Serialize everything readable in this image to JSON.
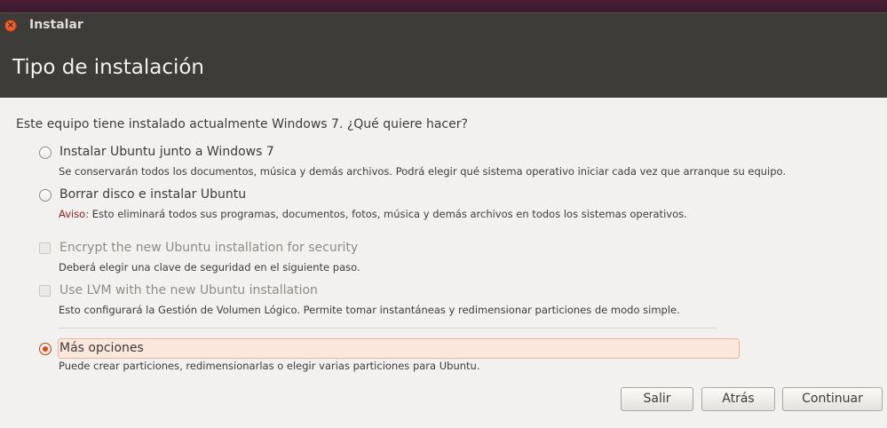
{
  "window": {
    "title": "Instalar",
    "close_icon": "close-icon"
  },
  "header": {
    "title": "Tipo de instalación"
  },
  "question": "Este equipo tiene instalado actualmente Windows 7. ¿Qué quiere hacer?",
  "options": [
    {
      "type": "radio",
      "label": "Instalar Ubuntu junto a Windows 7",
      "description": "Se conservarán todos los documentos, música y demás archivos. Podrá elegir qué sistema operativo iniciar cada vez que arranque su equipo.",
      "selected": false,
      "enabled": true
    },
    {
      "type": "radio",
      "label": "Borrar disco e instalar Ubuntu",
      "warning_prefix": "Aviso:",
      "description": " Esto eliminará todos sus programas, documentos, fotos, música y demás archivos en todos los sistemas operativos.",
      "selected": false,
      "enabled": true
    },
    {
      "type": "checkbox",
      "label": "Encrypt the new Ubuntu installation for security",
      "description": "Deberá elegir una clave de seguridad en el siguiente paso.",
      "checked": false,
      "enabled": false
    },
    {
      "type": "checkbox",
      "label": "Use LVM with the new Ubuntu installation",
      "description": "Esto configurará la Gestión de Volumen Lógico. Permite tomar instantáneas y redimensionar particiones de modo simple.",
      "checked": false,
      "enabled": false
    },
    {
      "type": "radio",
      "label": "Más opciones",
      "description": "Puede crear particiones, redimensionarlas o elegir varias particiones para Ubuntu.",
      "selected": true,
      "enabled": true
    }
  ],
  "buttons": {
    "quit": "Salir",
    "back": "Atrás",
    "continue": "Continuar"
  },
  "colors": {
    "accent": "#df4a16",
    "header_bg": "#3d3c38",
    "window_bg": "#f2f1f0",
    "warning": "#9a1a1a"
  }
}
